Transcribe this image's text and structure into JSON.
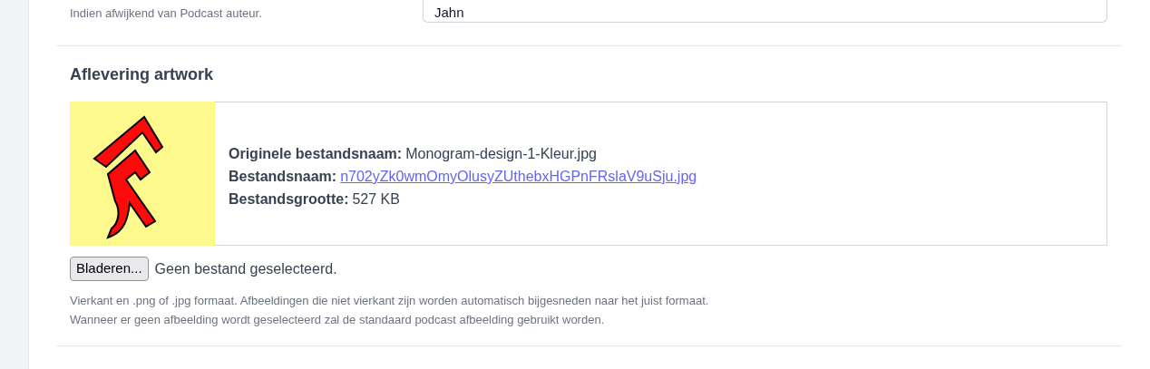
{
  "author_field": {
    "help": "Indien afwijkend van Podcast auteur.",
    "value": "Jahn"
  },
  "artwork": {
    "heading": "Aflevering artwork",
    "details": [
      {
        "label": "Originele bestandsnaam:",
        "value": "Monogram-design-1-Kleur.jpg",
        "kind": "text"
      },
      {
        "label": "Bestandsnaam:",
        "value": "n702yZk0wmOmyOlusyZUthebxHGPnFRslaV9uSju.jpg",
        "kind": "link"
      },
      {
        "label": "Bestandsgrootte:",
        "value": "527 KB",
        "kind": "text"
      }
    ],
    "browse_button": "Bladeren...",
    "file_status": "Geen bestand geselecteerd.",
    "help": [
      "Vierkant en .png of .jpg formaat. Afbeeldingen die niet vierkant zijn worden automatisch bijgesneden naar het juist formaat.",
      "Wanneer er geen afbeelding wordt geselecteerd zal de standaard podcast afbeelding gebruikt worden."
    ]
  }
}
